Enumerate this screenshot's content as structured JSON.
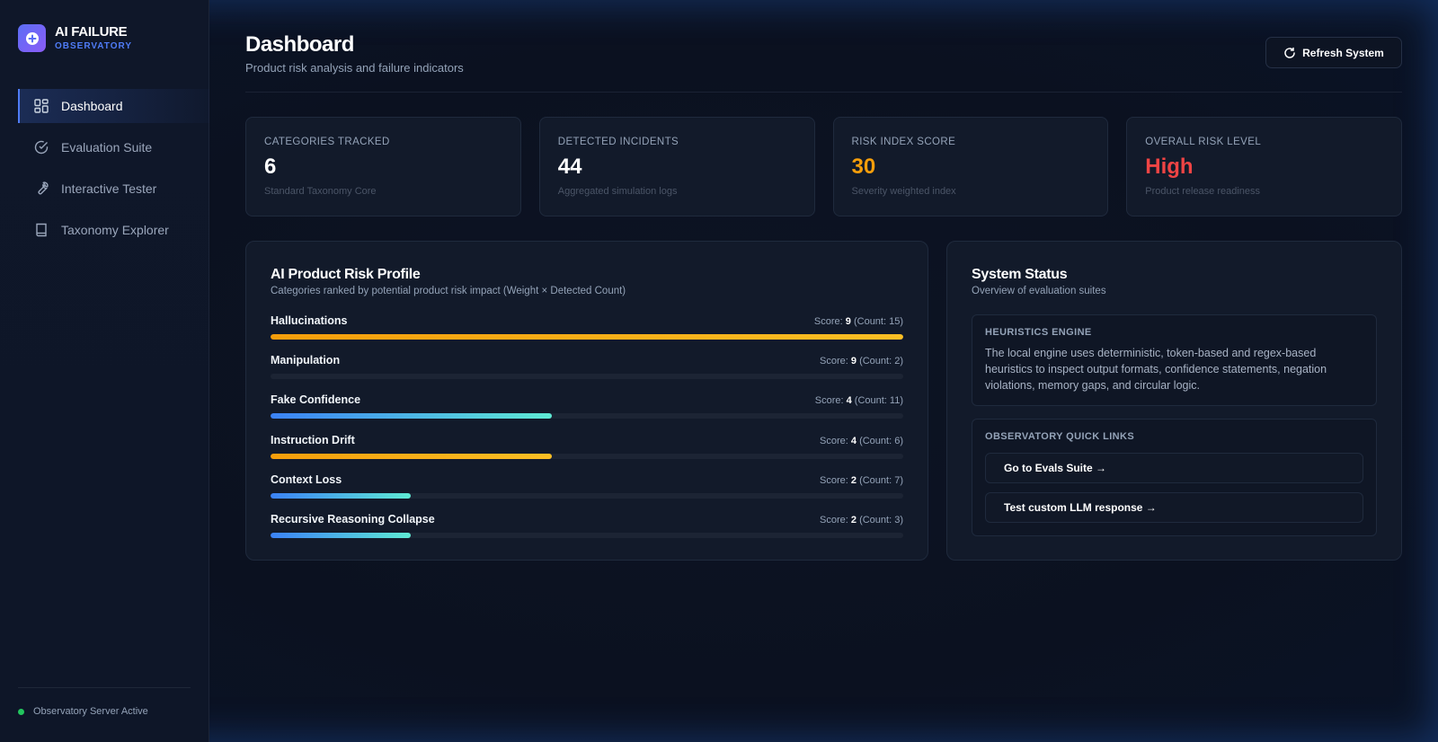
{
  "brand": {
    "title": "AI FAILURE",
    "subtitle": "OBSERVATORY"
  },
  "sidebar": {
    "items": [
      {
        "label": "Dashboard",
        "icon": "dashboard-icon",
        "active": true
      },
      {
        "label": "Evaluation Suite",
        "icon": "check-circle-icon",
        "active": false
      },
      {
        "label": "Interactive Tester",
        "icon": "wrench-icon",
        "active": false
      },
      {
        "label": "Taxonomy Explorer",
        "icon": "book-icon",
        "active": false
      }
    ],
    "footer_status": "Observatory Server Active"
  },
  "header": {
    "title": "Dashboard",
    "subtitle": "Product risk analysis and failure indicators",
    "refresh_label": "Refresh System"
  },
  "stats": [
    {
      "label": "CATEGORIES TRACKED",
      "value": "6",
      "note": "Standard Taxonomy Core",
      "color": "#ffffff"
    },
    {
      "label": "DETECTED INCIDENTS",
      "value": "44",
      "note": "Aggregated simulation logs",
      "color": "#ffffff"
    },
    {
      "label": "RISK INDEX SCORE",
      "value": "30",
      "note": "Severity weighted index",
      "color": "#f59e0b"
    },
    {
      "label": "OVERALL RISK LEVEL",
      "value": "High",
      "note": "Product release readiness",
      "color": "#ef4444"
    }
  ],
  "risk_profile": {
    "title": "AI Product Risk Profile",
    "subtitle": "Categories ranked by potential product risk impact (Weight × Detected Count)",
    "score_prefix": "Score: ",
    "items": [
      {
        "name": "Hallucinations",
        "score": "9",
        "count_text": "(Count: 15)",
        "fill_pct": 100,
        "color": "amber"
      },
      {
        "name": "Manipulation",
        "score": "9",
        "count_text": "(Count: 2)",
        "fill_pct": 0,
        "color": "amber"
      },
      {
        "name": "Fake Confidence",
        "score": "4",
        "count_text": "(Count: 11)",
        "fill_pct": 44.4,
        "color": "blue"
      },
      {
        "name": "Instruction Drift",
        "score": "4",
        "count_text": "(Count: 6)",
        "fill_pct": 44.4,
        "color": "amber"
      },
      {
        "name": "Context Loss",
        "score": "2",
        "count_text": "(Count: 7)",
        "fill_pct": 22.2,
        "color": "blue"
      },
      {
        "name": "Recursive Reasoning Collapse",
        "score": "2",
        "count_text": "(Count: 3)",
        "fill_pct": 22.2,
        "color": "blue"
      }
    ]
  },
  "system_status": {
    "title": "System Status",
    "subtitle": "Overview of evaluation suites",
    "engine_label": "HEURISTICS ENGINE",
    "engine_text": "The local engine uses deterministic, token-based and regex-based heuristics to inspect output formats, confidence statements, negation violations, memory gaps, and circular logic.",
    "links_label": "OBSERVATORY QUICK LINKS",
    "links": [
      {
        "label": "Go to Evals Suite →"
      },
      {
        "label": "Test custom LLM response →"
      }
    ]
  }
}
